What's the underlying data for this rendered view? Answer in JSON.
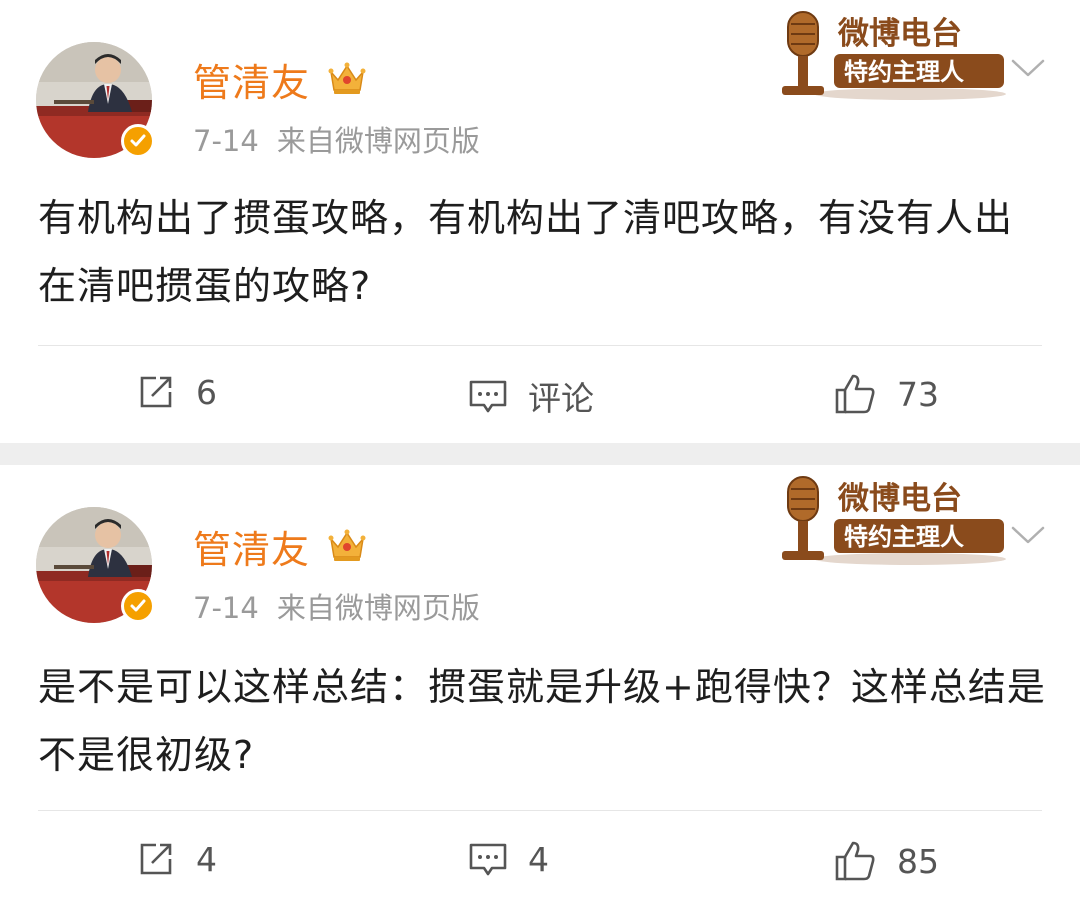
{
  "posts": [
    {
      "username": "管清友",
      "date": "7-14",
      "source": "来自微博网页版",
      "radio_title": "微博电台",
      "radio_subtitle": "特约主理人",
      "content": "有机构出了掼蛋攻略，有机构出了清吧攻略，有没有人出在清吧掼蛋的攻略?",
      "actions": {
        "repost": "6",
        "comment": "评论",
        "like": "73"
      }
    },
    {
      "username": "管清友",
      "date": "7-14",
      "source": "来自微博网页版",
      "radio_title": "微博电台",
      "radio_subtitle": "特约主理人",
      "content": "是不是可以这样总结：掼蛋就是升级+跑得快？这样总结是不是很初级?",
      "actions": {
        "repost": "4",
        "comment": "4",
        "like": "85"
      }
    }
  ],
  "colors": {
    "username": "#ee7a1b",
    "verified": "#f5a000",
    "meta": "#9a9a9a",
    "radio_brown": "#8a4b1c",
    "separator": "#eeeeee"
  },
  "icons": [
    "crown-icon",
    "verified-icon",
    "microphone-icon",
    "chevron-down-icon",
    "repost-icon",
    "comment-icon",
    "like-icon"
  ]
}
